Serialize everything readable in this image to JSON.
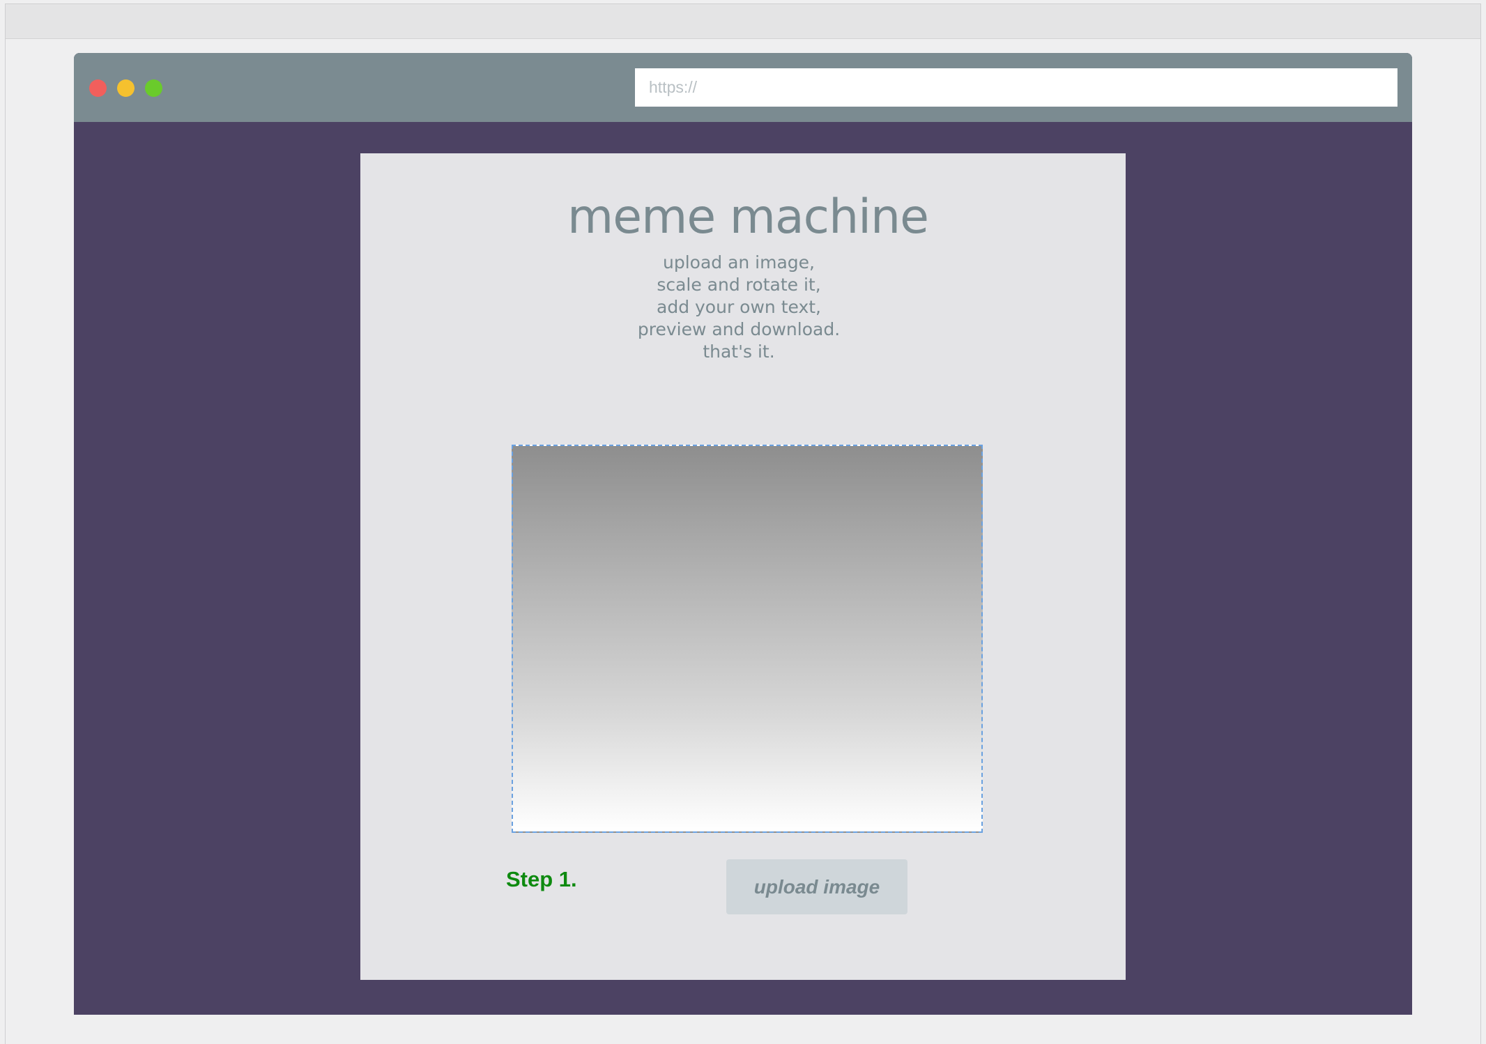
{
  "window": {
    "controls": [
      "close",
      "minimize",
      "maximize"
    ],
    "control_colors": {
      "close": "#f25f5c",
      "minimize": "#f5c12e",
      "maximize": "#6acb2b"
    }
  },
  "address_bar": {
    "placeholder": "https://",
    "value": ""
  },
  "app": {
    "title": "meme machine",
    "subtitle_lines": [
      "upload an image,",
      "scale and rotate it,",
      "add your own text,",
      "preview and download.",
      "that's it."
    ]
  },
  "step": {
    "label": "Step 1.",
    "button_label": "upload image"
  },
  "colors": {
    "page_background": "#4c4263",
    "chrome": "#7b8b91",
    "card": "#e4e4e7",
    "text": "#7a8a90",
    "step_accent": "#0e8a10",
    "canvas_border": "#6aa1e0",
    "button": "#cfd6da"
  },
  "icons": {
    "close": "close-dot-icon",
    "minimize": "minimize-dot-icon",
    "maximize": "maximize-dot-icon"
  }
}
